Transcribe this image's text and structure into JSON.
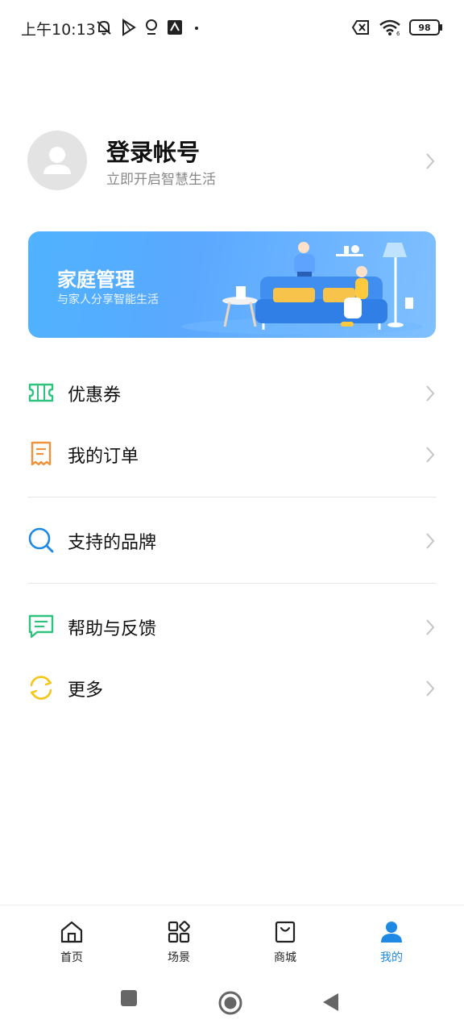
{
  "status_bar": {
    "time": "上午10:13",
    "battery": "98",
    "wifi_label": "6"
  },
  "profile": {
    "title": "登录帐号",
    "subtitle": "立即开启智慧生活"
  },
  "banner": {
    "title": "家庭管理",
    "subtitle": "与家人分享智能生活"
  },
  "menu": {
    "coupons": "优惠券",
    "orders": "我的订单",
    "brands": "支持的品牌",
    "feedback": "帮助与反馈",
    "more": "更多"
  },
  "bottom_nav": {
    "home": "首页",
    "scenes": "场景",
    "mall": "商城",
    "mine": "我的",
    "active": "mine"
  },
  "colors": {
    "accent": "#1e88e5",
    "coupon_icon": "#2ec27e",
    "order_icon": "#f0923a",
    "brand_icon": "#1e88e5",
    "feedback_icon": "#2ec27e",
    "more_icon": "#f5c518"
  }
}
